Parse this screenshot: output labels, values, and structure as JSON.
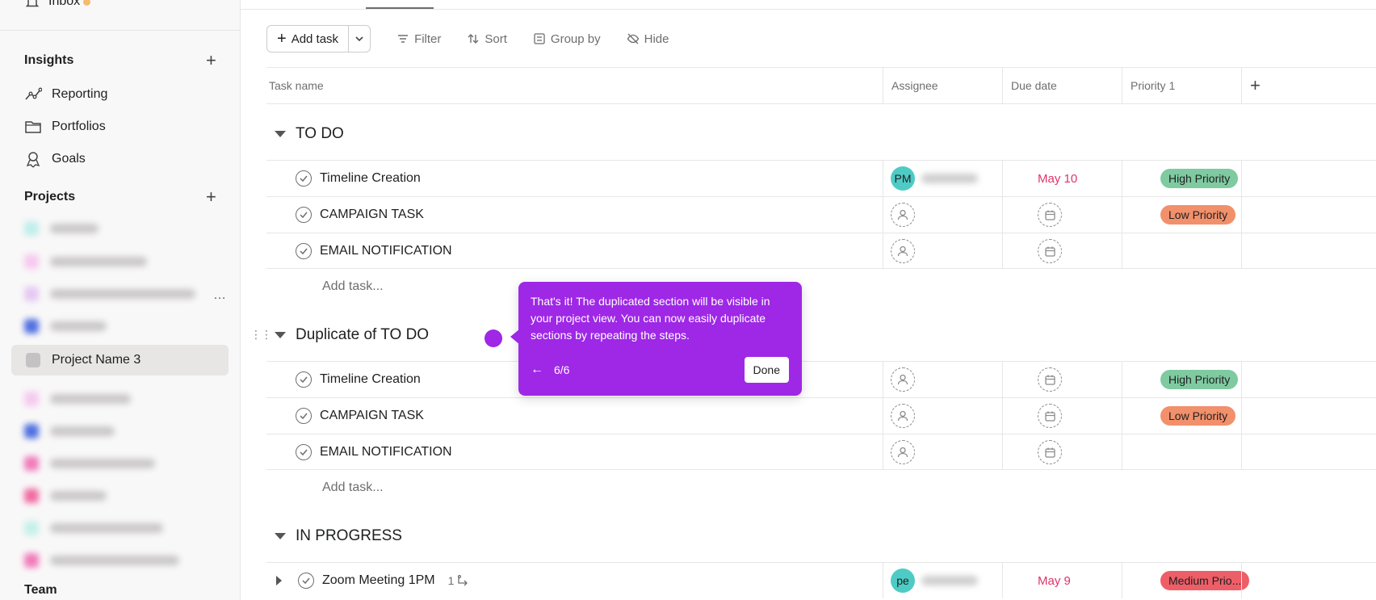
{
  "sidebar": {
    "inbox_label": "Inbox",
    "insights_heading": "Insights",
    "insights_items": [
      {
        "label": "Reporting",
        "icon": "reporting-icon"
      },
      {
        "label": "Portfolios",
        "icon": "folder-icon"
      },
      {
        "label": "Goals",
        "icon": "goals-icon"
      }
    ],
    "projects_heading": "Projects",
    "selected_project": "Project Name 3",
    "team_heading": "Team"
  },
  "toolbar": {
    "add_task": "Add task",
    "filter": "Filter",
    "sort": "Sort",
    "group_by": "Group by",
    "hide": "Hide"
  },
  "columns": {
    "task_name": "Task name",
    "assignee": "Assignee",
    "due_date": "Due date",
    "priority": "Priority 1"
  },
  "sections": [
    {
      "title": "TO DO",
      "tasks": [
        {
          "name": "Timeline Creation",
          "assignee": "PM",
          "due": "May 10",
          "priority": "High Priority"
        },
        {
          "name": "CAMPAIGN TASK",
          "assignee": "",
          "due": "",
          "priority": "Low Priority"
        },
        {
          "name": "EMAIL NOTIFICATION",
          "assignee": "",
          "due": "",
          "priority": ""
        }
      ],
      "add_task": "Add task..."
    },
    {
      "title": "Duplicate of TO DO",
      "tasks": [
        {
          "name": "Timeline Creation",
          "assignee": "",
          "due": "",
          "priority": "High Priority"
        },
        {
          "name": "CAMPAIGN TASK",
          "assignee": "",
          "due": "",
          "priority": "Low Priority"
        },
        {
          "name": "EMAIL NOTIFICATION",
          "assignee": "",
          "due": "",
          "priority": ""
        }
      ],
      "add_task": "Add task..."
    },
    {
      "title": "IN PROGRESS",
      "tasks": [
        {
          "name": "Zoom Meeting 1PM",
          "subtasks": "1",
          "assignee": "pe",
          "due": "May 9",
          "priority": "Medium Prio..."
        }
      ]
    }
  ],
  "tooltip": {
    "message": "That's it! The duplicated section will be visible in your project view. You can now easily duplicate sections by repeating the steps.",
    "back": "←",
    "step": "6/6",
    "done": "Done"
  },
  "colors": {
    "accent": "#9e28e6",
    "high_priority": "#7fcaa0",
    "low_priority": "#f1906b",
    "medium_priority": "#ee5e67",
    "due_red": "#e1336a",
    "avatar": "#4ecbc4"
  }
}
